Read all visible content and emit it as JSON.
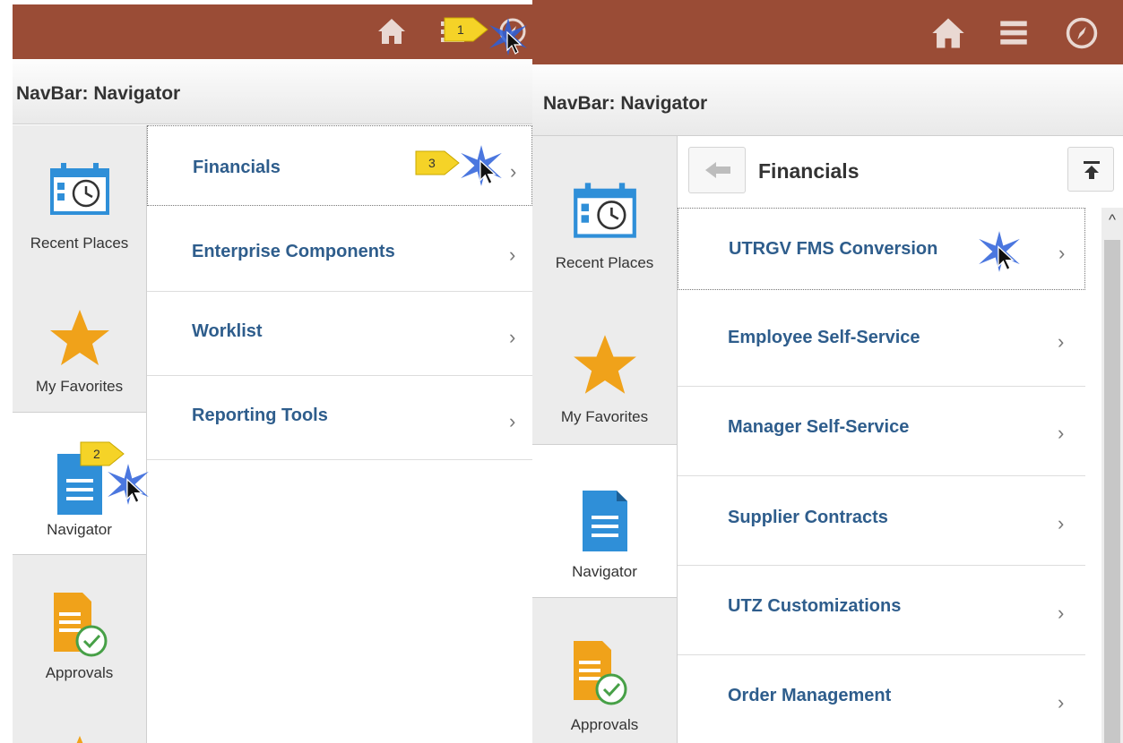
{
  "left": {
    "title": "NavBar: Navigator",
    "nav_items": [
      {
        "label": "Recent Places",
        "icon": "recent-places-icon"
      },
      {
        "label": "My Favorites",
        "icon": "star-icon"
      },
      {
        "label": "Navigator",
        "icon": "navigator-document-icon"
      },
      {
        "label": "Approvals",
        "icon": "approvals-icon"
      }
    ],
    "menu_items": [
      {
        "label": "Financials"
      },
      {
        "label": "Enterprise Components"
      },
      {
        "label": "Worklist"
      },
      {
        "label": "Reporting Tools"
      }
    ],
    "callouts": [
      "1",
      "2",
      "3"
    ]
  },
  "right": {
    "title": "NavBar: Navigator",
    "breadcrumb_title": "Financials",
    "nav_items": [
      {
        "label": "Recent Places",
        "icon": "recent-places-icon"
      },
      {
        "label": "My Favorites",
        "icon": "star-icon"
      },
      {
        "label": "Navigator",
        "icon": "navigator-document-icon"
      },
      {
        "label": "Approvals",
        "icon": "approvals-icon"
      }
    ],
    "menu_items": [
      {
        "label": "UTRGV FMS Conversion"
      },
      {
        "label": "Employee Self-Service"
      },
      {
        "label": "Manager Self-Service"
      },
      {
        "label": "Supplier Contracts"
      },
      {
        "label": "UTZ Customizations"
      },
      {
        "label": "Order Management"
      }
    ]
  },
  "chevron": "›",
  "scroll_up_glyph": "^",
  "colors": {
    "header_bg": "#9a4c36",
    "link_text": "#2e5d8c",
    "icon_blue": "#2f8fd8",
    "icon_orange": "#f0a21a",
    "callout_yellow": "#f5d327"
  }
}
